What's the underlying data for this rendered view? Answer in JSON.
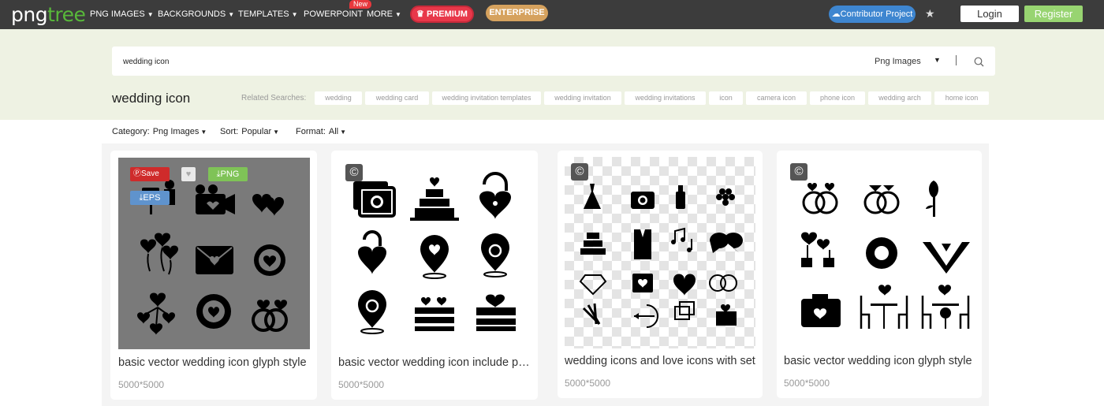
{
  "header": {
    "logo_part1": "png",
    "logo_part2": "tree",
    "nav": [
      {
        "label": "PNG IMAGES"
      },
      {
        "label": "BACKGROUNDS"
      },
      {
        "label": "TEMPLATES"
      },
      {
        "label": "POWERPOINT"
      },
      {
        "label": "MORE"
      }
    ],
    "new_badge": "New",
    "premium": "PREMIUM",
    "enterprise": "ENTERPRISE",
    "contributor": "Contributor Project",
    "login": "Login",
    "register": "Register",
    "colors": {
      "bar": "#3c3c3c",
      "premium": "#e8384a",
      "enterprise": "#d6a25e",
      "contributor": "#3e86d0",
      "register": "#98d471",
      "brand_green": "#58b93a"
    }
  },
  "search": {
    "query": "wedding icon",
    "category": "Png Images",
    "icon": "search-icon"
  },
  "page_title": "wedding icon",
  "related": {
    "label": "Related Searches:",
    "tags": [
      "wedding",
      "wedding card",
      "wedding invitation templates",
      "wedding invitation",
      "wedding invitations",
      "icon",
      "camera icon",
      "phone icon",
      "wedding arch",
      "home icon"
    ]
  },
  "filters": {
    "category_label": "Category:",
    "category_value": "Png Images",
    "sort_label": "Sort:",
    "sort_value": "Popular",
    "format_label": "Format:",
    "format_value": "All"
  },
  "overlay": {
    "save": "Save",
    "png": "PNG",
    "eps": "EPS"
  },
  "cards": [
    {
      "title": "basic vector wedding icon glyph style",
      "dims": "5000*5000"
    },
    {
      "title": "basic vector wedding icon include pack",
      "dims": "5000*5000"
    },
    {
      "title": "wedding icons and love icons with set",
      "dims": "5000*5000"
    },
    {
      "title": "basic vector wedding icon glyph style",
      "dims": "5000*5000"
    }
  ]
}
